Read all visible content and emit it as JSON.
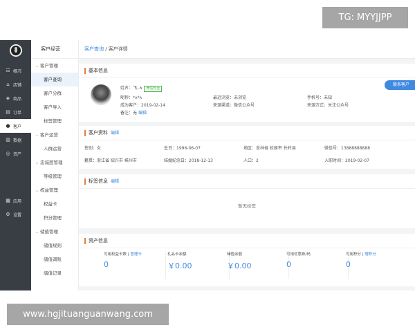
{
  "watermarks": {
    "top": "TG: MYYJJPP",
    "bottom": "www.hgjituanguanwang.com"
  },
  "rail": {
    "items": [
      {
        "icon": "overview-icon",
        "glyph": "☷",
        "label": "概况"
      },
      {
        "icon": "store-icon",
        "glyph": "⌂",
        "label": "店铺"
      },
      {
        "icon": "tag-icon",
        "glyph": "◈",
        "label": "商品"
      },
      {
        "icon": "order-icon",
        "glyph": "▤",
        "label": "订单"
      },
      {
        "icon": "user-icon",
        "glyph": "●",
        "label": "客户"
      },
      {
        "icon": "data-icon",
        "glyph": "▥",
        "label": "数据"
      },
      {
        "icon": "asset-icon",
        "glyph": "◎",
        "label": "资产"
      },
      {
        "icon": "apps-icon",
        "glyph": "▦",
        "label": "应用"
      },
      {
        "icon": "settings-icon",
        "glyph": "⚙",
        "label": "设置"
      }
    ]
  },
  "sub": {
    "title": "客户经营",
    "groups": [
      {
        "label": "客户管理",
        "items": [
          "客户查询",
          "客户分群",
          "客户导入",
          "标签管理"
        ]
      },
      {
        "label": "客户运营",
        "items": [
          "人群运营"
        ]
      },
      {
        "label": "忠诚度管理",
        "items": [
          "等级管理"
        ]
      },
      {
        "label": "权益管理",
        "items": [
          "权益卡",
          "积分管理"
        ]
      },
      {
        "label": "储值管理",
        "items": [
          "储值规则",
          "储值调账",
          "储值记录"
        ]
      }
    ]
  },
  "breadcrumb": {
    "link": "客户查询",
    "sep": " / ",
    "current": "客户详情"
  },
  "basic": {
    "title": "基本信息",
    "name_label": "姓名：",
    "name_value": "飞..ʌ",
    "tag": "微信粉丝",
    "nick_label": "昵称：",
    "nick_value": "*ʌ*ʌ",
    "become_label": "成为客户：",
    "become_value": "2019-02-14",
    "note_label": "备注：",
    "note_value": "无",
    "note_edit": "编辑",
    "visit_label": "最近浏览：",
    "visit_value": "未浏览",
    "source_label": "来源渠道：",
    "source_value": "微信公众号",
    "phone_label": "手机号：",
    "phone_value": "未知",
    "way_label": "来源方式：",
    "way_value": "关注公众号",
    "contact_button": "联系客户"
  },
  "profile": {
    "title": "客户资料",
    "edit": "编辑",
    "gender_label": "性别：",
    "gender_value": "女",
    "birthday_label": "生日：",
    "birthday_value": "1996-06-07",
    "region_label": "地区：",
    "region_value": "吉林省 松原市 长岭县",
    "wechat_label": "微信号：",
    "wechat_value": "13888888888",
    "native_label": "籍贯：",
    "native_value": "浙江省 绍兴市 嵊州市",
    "anniv_label": "结婚纪念日：",
    "anniv_value": "2018-12-13",
    "population_label": "人口：",
    "population_value": "2",
    "join_label": "入职时间：",
    "join_value": "2019-02-07"
  },
  "tags": {
    "title": "标签信息",
    "edit": "编辑",
    "empty": "暂无标签"
  },
  "assets": {
    "title": "资产信息",
    "items": [
      {
        "label": "可用权益卡数 |",
        "link": "管理卡",
        "value": "0"
      },
      {
        "label": "礼品卡余额",
        "link": "",
        "value": "￥0.00"
      },
      {
        "label": "储值余额",
        "link": "",
        "value": "￥0.00"
      },
      {
        "label": "可用优惠券/码",
        "link": "",
        "value": "0"
      },
      {
        "label": "可用积分 |",
        "link": "赠积分",
        "value": "0"
      }
    ]
  }
}
